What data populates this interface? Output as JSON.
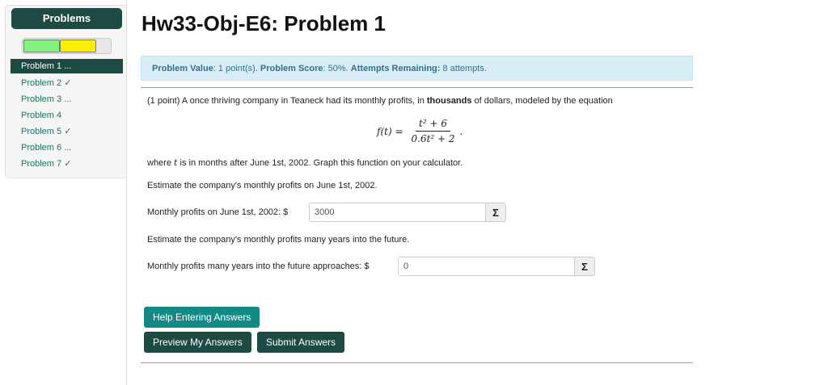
{
  "sidebar": {
    "title": "Problems",
    "progress": {
      "correct_fraction": 0.42,
      "partial_fraction": 0.42
    },
    "items": [
      {
        "label": "Problem 1 ..."
      },
      {
        "label": "Problem 2 ✓"
      },
      {
        "label": "Problem 3 ..."
      },
      {
        "label": "Problem 4"
      },
      {
        "label": "Problem 5 ✓"
      },
      {
        "label": "Problem 6 ..."
      },
      {
        "label": "Problem 7 ✓"
      }
    ]
  },
  "header": {
    "title": "Hw33-Obj-E6: Problem 1"
  },
  "info": {
    "value_label": "Problem Value",
    "value_text": ": 1 point(s).",
    "score_label": "Problem Score",
    "score_text": ": 50%.",
    "attempts_label": "Attempts Remaining:",
    "attempts_text": " 8 attempts."
  },
  "problem": {
    "intro_before": "(1 point) A once thriving company in Teaneck had its monthly profits, in ",
    "intro_bold": "thousands",
    "intro_after": " of dollars, modeled by the equation",
    "equation": {
      "lhs": "f(t) =",
      "numerator": "t² + 6",
      "denominator": "0.6t² + 2",
      "end": "."
    },
    "where_before": "where ",
    "where_var": "t",
    "where_after": "  is in months after June 1st, 2002. Graph this function on your calculator.",
    "q1_prompt": "Estimate the company's monthly profits on June 1st, 2002.",
    "q1_label": "Monthly profits on June 1st, 2002: $",
    "q1_value": "3000",
    "q2_prompt": "Estimate the company's monthly profits many years into the future.",
    "q2_label": "Monthly profits many years into the future approaches: $",
    "q2_value": "0",
    "sigma": "Σ"
  },
  "buttons": {
    "help": "Help Entering Answers",
    "preview": "Preview My Answers",
    "submit": "Submit Answers"
  },
  "colors": {
    "brand_dark": "#1d4a43",
    "help_teal": "#138a86",
    "info_bg": "#d9edf7",
    "info_text": "#31708f",
    "progress_correct": "#83f27f",
    "progress_partial": "#ffee00"
  }
}
